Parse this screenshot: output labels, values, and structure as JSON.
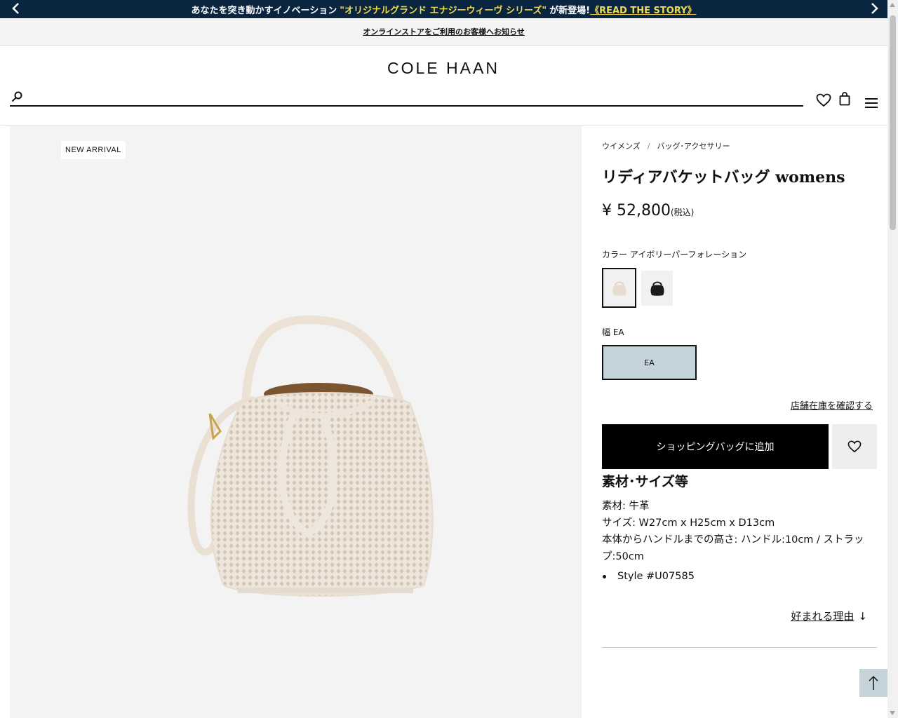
{
  "promo": {
    "text_before": "あなたを突き動かすイノベーション",
    "highlight": "\"オリジナルグランド エナジーウィーヴ シリーズ\"",
    "text_after": "が新登場!",
    "link": "《READ THE STORY》",
    "prev_icon": "chevron-left-icon",
    "next_icon": "chevron-right-icon"
  },
  "notice": {
    "link": "オンラインストアをご利用のお客様へお知らせ"
  },
  "header": {
    "logo": "COLE HAAN",
    "search_placeholder": "",
    "icons": [
      "search-icon",
      "heart-icon",
      "shopping-bag-icon",
      "menu-icon"
    ]
  },
  "gallery": {
    "badge": "NEW ARRIVAL",
    "image": "perforated-bucket-bag"
  },
  "product": {
    "breadcrumbs": [
      "ウイメンズ",
      "バッグ･アクセサリー"
    ],
    "breadcrumb_sep": "/",
    "title": "リディアバケットバッグ womens",
    "price": "¥ 52,800",
    "tax_note": "(税込)",
    "color_label": "カラー アイボリーパーフォレーション",
    "swatches": [
      {
        "name": "ivory",
        "selected": true,
        "color": "#e7dcd0"
      },
      {
        "name": "black",
        "selected": false,
        "color": "#1a1a1a"
      }
    ],
    "width_label": "幅 EA",
    "width_option": "EA",
    "stock_link": "店舗在庫を確認する",
    "add_to_bag": "ショッピングバッグに追加",
    "spec_heading": "素材･サイズ等",
    "specs": [
      "素材: 牛革",
      "サイズ: W27cm x H25cm x D13cm",
      "本体からハンドルまでの高さ: ハンドル:10cm / ストラップ:50cm"
    ],
    "style_no": "Style #U07585",
    "reasons_link": "好まれる理由"
  },
  "colors": {
    "promo_bg": "#0a2540",
    "promo_highlight": "#f2d94e",
    "width_selected_bg": "#c5d3da",
    "button_bg": "#000000"
  }
}
